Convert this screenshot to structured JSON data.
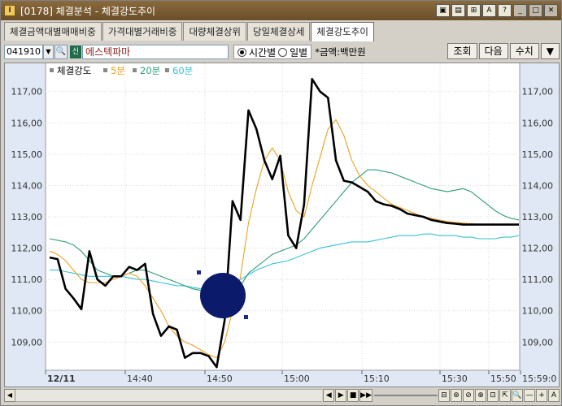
{
  "window": {
    "title": "[0178]  체결분석 - 체결강도추이",
    "app_icon": "I",
    "title_buttons": [
      "▣",
      "▤",
      "⊞",
      "A",
      "?",
      "_",
      "□",
      "✕"
    ]
  },
  "tabs": [
    {
      "label": "체결금액대별매매비중",
      "active": false
    },
    {
      "label": "가격대별거래비중",
      "active": false
    },
    {
      "label": "대량체결상위",
      "active": false
    },
    {
      "label": "당일체결상세",
      "active": false
    },
    {
      "label": "체결강도추이",
      "active": true
    }
  ],
  "toolbar": {
    "code_value": "041910",
    "shin_badge": "신",
    "stock_name": "에스텍파마",
    "radio_time": "시간별",
    "radio_day": "일별",
    "unit_label": "*금액:백만원",
    "btn_query": "조회",
    "btn_next": "다음",
    "btn_value": "수치",
    "btn_menu": "▼"
  },
  "chart_data": {
    "type": "line",
    "legend": [
      {
        "name": "체결강도",
        "color": "#000000"
      },
      {
        "name": "5분",
        "color": "#f0a020"
      },
      {
        "name": "20분",
        "color": "#2a9d7a"
      },
      {
        "name": "60분",
        "color": "#39c0d8"
      }
    ],
    "y_ticks": [
      "117,00",
      "116,00",
      "115,00",
      "114,00",
      "113,00",
      "112,00",
      "111,00",
      "110,00",
      "109,00"
    ],
    "x_ticks": [
      "12/11",
      "14:40",
      "14:50",
      "15:00",
      "15:10",
      "15:30",
      "15:50",
      "15:59:0"
    ],
    "ylim": [
      108.1,
      117.9
    ],
    "series": [
      {
        "name": "체결강도",
        "color": "#000000",
        "values": [
          111.7,
          111.65,
          110.7,
          110.4,
          110.05,
          111.9,
          111.0,
          110.8,
          111.1,
          111.1,
          111.4,
          111.3,
          111.5,
          109.9,
          109.2,
          109.5,
          109.4,
          108.5,
          108.65,
          108.65,
          108.55,
          108.2,
          109.7,
          113.5,
          112.9,
          116.4,
          115.8,
          114.8,
          114.2,
          114.95,
          112.4,
          112.0,
          113.4,
          117.4,
          117.0,
          116.8,
          114.8,
          114.15,
          114.1,
          113.95,
          113.8,
          113.5,
          113.4,
          113.35,
          113.25,
          113.1,
          113.05,
          113.0,
          112.9,
          112.85,
          112.8,
          112.78,
          112.75,
          112.75,
          112.75,
          112.75,
          112.75,
          112.75,
          112.75,
          112.75
        ]
      },
      {
        "name": "5분",
        "color": "#f0a020",
        "values": [
          111.9,
          111.8,
          111.6,
          111.3,
          111.0,
          110.9,
          110.9,
          110.9,
          111.0,
          111.1,
          111.2,
          111.1,
          110.8,
          110.4,
          110.0,
          109.5,
          109.2,
          109.0,
          108.9,
          108.75,
          108.6,
          108.5,
          109.0,
          110.0,
          111.1,
          112.8,
          113.9,
          114.8,
          115.2,
          114.8,
          113.8,
          113.2,
          113.0,
          114.0,
          114.9,
          115.8,
          116.1,
          115.6,
          114.8,
          114.3,
          114.0,
          113.8,
          113.6,
          113.4,
          113.3,
          113.2,
          113.1,
          113.0,
          112.95,
          112.9,
          112.85,
          112.82,
          112.8,
          112.78,
          112.76,
          112.75,
          112.75,
          112.75,
          112.75,
          112.75
        ]
      },
      {
        "name": "20분",
        "color": "#2a9d7a",
        "values": [
          112.3,
          112.25,
          112.2,
          112.1,
          111.9,
          111.6,
          111.3,
          111.2,
          111.1,
          111.1,
          111.2,
          111.3,
          111.3,
          111.2,
          111.1,
          111.0,
          110.9,
          110.8,
          110.7,
          110.65,
          110.6,
          110.5,
          110.4,
          110.6,
          110.8,
          111.2,
          111.4,
          111.6,
          111.8,
          111.9,
          112.0,
          112.1,
          112.3,
          112.6,
          112.9,
          113.2,
          113.5,
          113.8,
          114.1,
          114.3,
          114.5,
          114.5,
          114.45,
          114.4,
          114.3,
          114.2,
          114.1,
          114.0,
          113.9,
          113.85,
          113.8,
          113.85,
          113.9,
          113.8,
          113.6,
          113.4,
          113.2,
          113.05,
          112.95,
          112.9
        ]
      },
      {
        "name": "60분",
        "color": "#39c0d8",
        "values": [
          111.3,
          111.3,
          111.25,
          111.2,
          111.15,
          111.1,
          111.1,
          111.1,
          111.1,
          111.1,
          111.05,
          111.0,
          111.0,
          110.95,
          110.9,
          110.85,
          110.8,
          110.8,
          110.75,
          110.7,
          110.7,
          110.75,
          110.8,
          110.9,
          111.0,
          111.15,
          111.3,
          111.4,
          111.5,
          111.55,
          111.6,
          111.7,
          111.8,
          111.9,
          112.0,
          112.05,
          112.1,
          112.15,
          112.2,
          112.2,
          112.2,
          112.25,
          112.3,
          112.35,
          112.4,
          112.4,
          112.4,
          112.45,
          112.45,
          112.4,
          112.4,
          112.4,
          112.35,
          112.35,
          112.3,
          112.3,
          112.3,
          112.35,
          112.35,
          112.4
        ]
      }
    ]
  },
  "statusbar": {
    "controls": [
      "◀",
      "▶",
      "■",
      "▶▶"
    ],
    "zoom_controls": [
      "⊟",
      "⊛",
      "⊘",
      "⊕",
      "⊡",
      "⇱",
      "🔍",
      "—",
      "+",
      "A"
    ]
  }
}
